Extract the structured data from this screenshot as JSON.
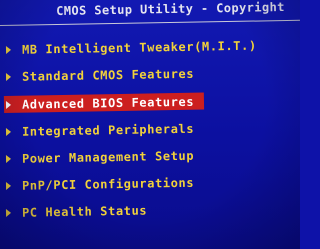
{
  "header": {
    "title": "CMOS Setup Utility - Copyright"
  },
  "colors": {
    "background": "#1219b2",
    "item_text": "#f2d23a",
    "selected_background": "#cc1f1f",
    "selected_text": "#ffffff"
  },
  "menu": {
    "selected_index": 2,
    "items": [
      {
        "label": "MB Intelligent Tweaker(M.I.T.)",
        "icon": "triangle-arrow"
      },
      {
        "label": "Standard CMOS Features",
        "icon": "triangle-arrow"
      },
      {
        "label": "Advanced BIOS Features",
        "icon": "triangle-arrow"
      },
      {
        "label": "Integrated Peripherals",
        "icon": "triangle-arrow"
      },
      {
        "label": "Power Management Setup",
        "icon": "triangle-arrow"
      },
      {
        "label": "PnP/PCI Configurations",
        "icon": "triangle-arrow"
      },
      {
        "label": "PC Health Status",
        "icon": "triangle-arrow"
      }
    ]
  }
}
